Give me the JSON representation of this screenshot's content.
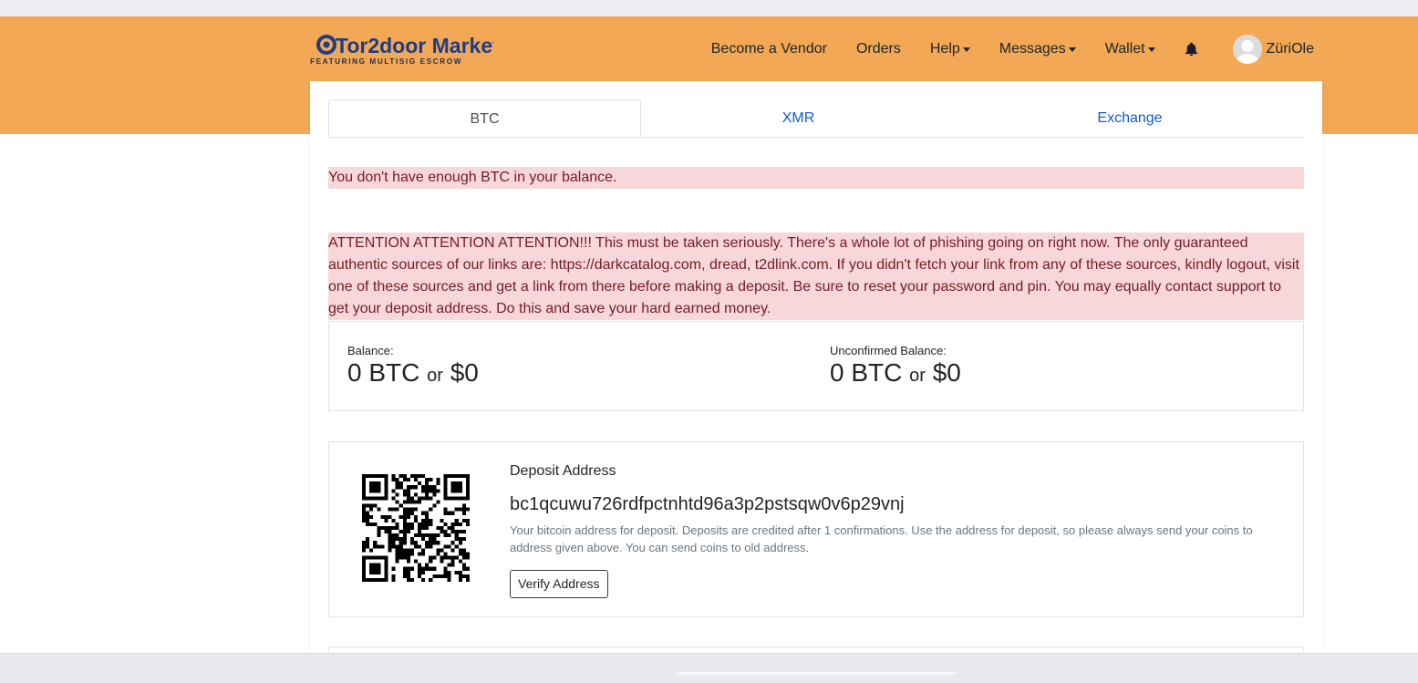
{
  "brand": {
    "name": "Tor2door Market",
    "tagline": "FEATURING MULTISIG ESCROW"
  },
  "nav": {
    "become_vendor": "Become a Vendor",
    "orders": "Orders",
    "help": "Help",
    "messages": "Messages",
    "wallet": "Wallet",
    "username": "ZüriOle"
  },
  "tabs": [
    "BTC",
    "XMR",
    "Exchange"
  ],
  "alerts": {
    "insufficient": "You don't have enough BTC in your balance.",
    "phishing": "ATTENTION ATTENTION ATTENTION!!! This must be taken seriously. There's a whole lot of phishing going on right now. The only guaranteed authentic sources of our links are: https://darkcatalog.com, dread, t2dlink.com. If you didn't fetch your link from any of these sources, kindly logout, visit one of these sources and get a link from there before making a deposit. Be sure to reset your password and pin. You may equally contact support to get your deposit address. Do this and save your hard earned money."
  },
  "balance": {
    "label": "Balance:",
    "btc": "0 BTC",
    "or": "or",
    "usd": "$0"
  },
  "unconfirmed": {
    "label": "Unconfirmed Balance:",
    "btc": "0 BTC",
    "or": "or",
    "usd": "$0"
  },
  "deposit": {
    "title": "Deposit Address",
    "address": "bc1qcuwu726rdfpctnhtd96a3p2pstsqw0v6p29vnj",
    "note": "Your bitcoin address for deposit. Deposits are credited after 1 confirmations. Use the address for deposit, so please always send your coins to address given above. You can send coins to old address.",
    "verify_button": "Verify Address"
  },
  "colors": {
    "header": "#f2a854",
    "alert_bg": "#f8d7da",
    "alert_text": "#721c24",
    "link": "#0d5bd1"
  }
}
